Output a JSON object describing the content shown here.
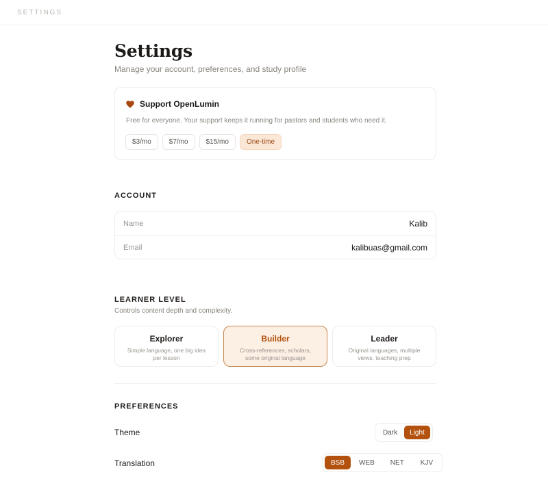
{
  "topbar": {
    "title": "SETTINGS"
  },
  "page": {
    "title": "Settings",
    "subtitle": "Manage your account, preferences, and study profile"
  },
  "support": {
    "icon": "heart-icon",
    "title": "Support OpenLumin",
    "description": "Free for everyone. Your support keeps it running for pastors and students who need it.",
    "tiers": [
      "$3/mo",
      "$7/mo",
      "$15/mo",
      "One-time"
    ],
    "selected_tier": "One-time"
  },
  "account": {
    "heading": "ACCOUNT",
    "fields": [
      {
        "label": "Name",
        "value": "Kalib"
      },
      {
        "label": "Email",
        "value": "kalibuas@gmail.com"
      }
    ]
  },
  "learner": {
    "heading": "LEARNER LEVEL",
    "description": "Controls content depth and complexity.",
    "levels": [
      {
        "name": "Explorer",
        "description": "Simple language, one big idea per lesson"
      },
      {
        "name": "Builder",
        "description": "Cross-references, scholars, some original language"
      },
      {
        "name": "Leader",
        "description": "Original languages, multiple views, teaching prep"
      }
    ],
    "selected": "Builder"
  },
  "preferences": {
    "heading": "PREFERENCES",
    "theme": {
      "label": "Theme",
      "options": [
        "Dark",
        "Light"
      ],
      "selected": "Light"
    },
    "translation": {
      "label": "Translation",
      "options": [
        "BSB",
        "WEB",
        "NET",
        "KJV"
      ],
      "selected": "BSB"
    }
  },
  "colors": {
    "accent": "#b3520f",
    "accent_soft": "#fbe7d6",
    "heart": "#a8480f"
  }
}
